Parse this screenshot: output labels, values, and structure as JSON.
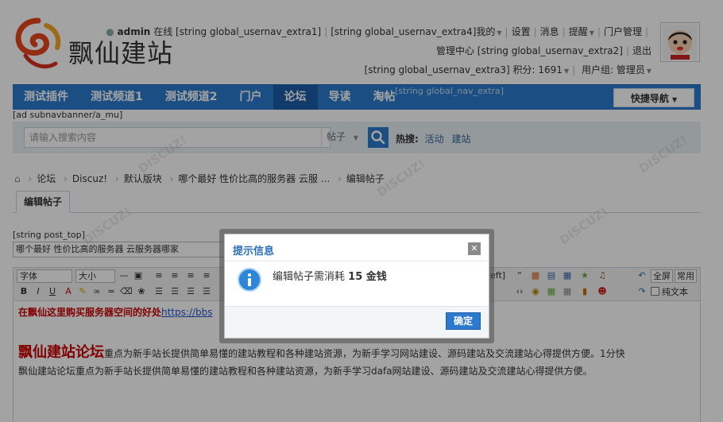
{
  "site": {
    "name": "飘仙建站"
  },
  "usernav": {
    "row1": {
      "username": "admin",
      "online": "在线",
      "extra1": "[string global_usernav_extra1]",
      "extra4": "[string global_usernav_extra4]我的",
      "settings": "设置",
      "messages": "消息",
      "remind": "提醒",
      "portal_manage": "门户管理"
    },
    "row2": {
      "admin_center": "管理中心",
      "extra2": "[string global_usernav_extra2]",
      "logout": "退出"
    },
    "row3": {
      "extra3": "[string global_usernav_extra3]",
      "credits": "积分: 1691",
      "usergroup": "用户组: 管理员"
    }
  },
  "nav": {
    "items": [
      "测试插件",
      "测试频道1",
      "测试频道2",
      "门户",
      "论坛",
      "导读",
      "淘帖"
    ],
    "active_index": 4,
    "extra": "[string global_nav_extra]",
    "quick_nav": "快捷导航"
  },
  "ad": "[ad subnavbanner/a_mu]",
  "search": {
    "placeholder": "请输入搜索内容",
    "type": "帖子",
    "hot_label": "热搜:",
    "hot_links": [
      "活动",
      "建站"
    ]
  },
  "breadcrumb": {
    "items": [
      "论坛",
      "Discuz!",
      "默认版块",
      "哪个最好 性价比高的服务器 云服 ...",
      "编辑帖子"
    ]
  },
  "tab": {
    "label": "编辑帖子"
  },
  "post": {
    "top_label": "[string post_top]",
    "subject": "哪个最好 性价比高的服务器 云服务器哪家"
  },
  "editor": {
    "font": "字体",
    "size": "大小",
    "fullscreen": "全屏",
    "common": "常用",
    "plaintext": "纯文本",
    "left_label": "left]",
    "promo_text": "在飘仙这里购买服务器空间的好处",
    "promo_url": "https://bbs",
    "brand": "飘仙建站论坛",
    "body1": "重点为新手站长提供简单易懂的建站教程和各种建站资源，为新手学习网站建设、源码建站及交流建站心得提供方便。1分快",
    "body2": "飘仙建站论坛重点为新手站长提供简单易懂的建站教程和各种建站资源，为新手学习dafa网站建设、源码建站及交流建站心得提供方便。"
  },
  "dialog": {
    "title": "提示信息",
    "message_prefix": "编辑帖子需消耗",
    "message_amount": "15 金钱",
    "confirm": "确定"
  },
  "colors": {
    "nav_blue": "#2b7acd",
    "nav_active": "#1c5da8",
    "promo_red": "#cc0000",
    "dialog_title": "#2b6fb8"
  }
}
